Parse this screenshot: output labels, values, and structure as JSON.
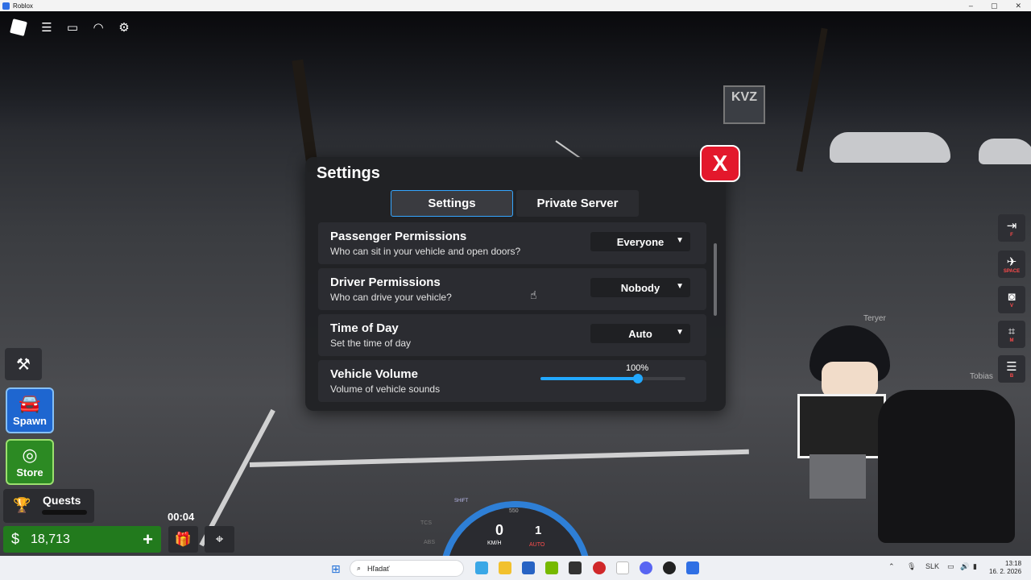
{
  "window": {
    "title": "Roblox",
    "controls": [
      "–",
      "▢",
      "✕"
    ]
  },
  "topbar": {
    "icons": [
      "roblox-logo-icon",
      "menu-icon",
      "chat-icon",
      "headset-icon",
      "gear-icon"
    ]
  },
  "scene": {
    "sign_text": "KVZ",
    "player_names": [
      "Teryer",
      "Tobias"
    ]
  },
  "settings": {
    "title": "Settings",
    "close_label": "X",
    "tabs": [
      {
        "label": "Settings",
        "active": true
      },
      {
        "label": "Private Server",
        "active": false
      }
    ],
    "rows": [
      {
        "title": "Passenger Permissions",
        "description": "Who can sit in your vehicle and open doors?",
        "value": "Everyone"
      },
      {
        "title": "Driver Permissions",
        "description": "Who can drive your vehicle?",
        "value": "Nobody"
      },
      {
        "title": "Time of Day",
        "description": "Set the time of day",
        "value": "Auto"
      }
    ],
    "volume": {
      "title": "Vehicle Volume",
      "description": "Volume of vehicle sounds",
      "value_label": "100%",
      "level": 0.67
    }
  },
  "hud": {
    "spawn_label": "Spawn",
    "store_label": "Store",
    "quests_label": "Quests",
    "currency_symbol": "$",
    "money": "18,713",
    "plus_label": "+",
    "timer": "00:04"
  },
  "right_hud": {
    "buttons": [
      {
        "icon": "exit-vehicle-icon",
        "key": "F"
      },
      {
        "icon": "headlight-icon",
        "key": "SPACE"
      },
      {
        "icon": "camera-icon",
        "key": "V"
      },
      {
        "icon": "gear-shift-icon",
        "key": "M"
      },
      {
        "icon": "menu-icon",
        "key": "B"
      }
    ]
  },
  "speedometer": {
    "shift_label": "SHIFT",
    "rpm_label": "550",
    "speed": "0",
    "unit": "KM/H",
    "gear": "1",
    "mode": "AUTO",
    "tcs_label": "TCS",
    "abs_label": "ABS"
  },
  "taskbar": {
    "search_placeholder": "Hľadať",
    "language": "SLK",
    "time": "13:18",
    "date": "16. 2. 2026"
  }
}
